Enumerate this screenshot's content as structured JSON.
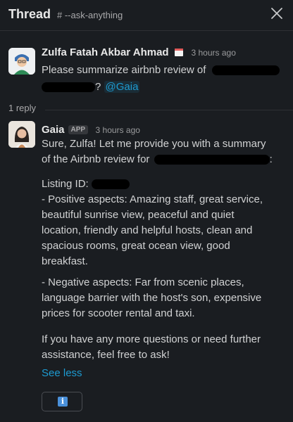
{
  "header": {
    "title": "Thread",
    "channel": "# --ask-anything"
  },
  "messages": [
    {
      "author": "Zulfa Fatah Akbar Ahmad",
      "time": "3 hours ago",
      "text_line1": "Please summarize airbnb review of",
      "text_line2_suffix": "?",
      "mention": "@Gaia"
    },
    {
      "author": "Gaia",
      "badge": "APP",
      "time": "3 hours ago",
      "intro_line1": "Sure, Zulfa! Let me provide you with a summary",
      "intro_line2": "of the Airbnb review for",
      "intro_line2_suffix": ":",
      "listing_label": "Listing ID:",
      "positive": [
        "- Positive aspects: Amazing staff, great service,",
        "beautiful sunrise view, peaceful and quiet",
        "location, friendly and helpful hosts, clean and",
        "spacious rooms, great ocean view, good",
        "breakfast."
      ],
      "negative": [
        "- Negative aspects: Far from scenic places,",
        "language barrier with the host's son, expensive",
        "prices for scooter rental and taxi."
      ],
      "closing": [
        "If you have any more questions or need further",
        "assistance, feel free to ask!"
      ],
      "see_less": "See less"
    }
  ],
  "reply_count": "1 reply",
  "info_icon": "info-icon",
  "colors": {
    "background": "#1a1d21",
    "link": "#1d9bd1",
    "text": "#d1d2d3"
  }
}
